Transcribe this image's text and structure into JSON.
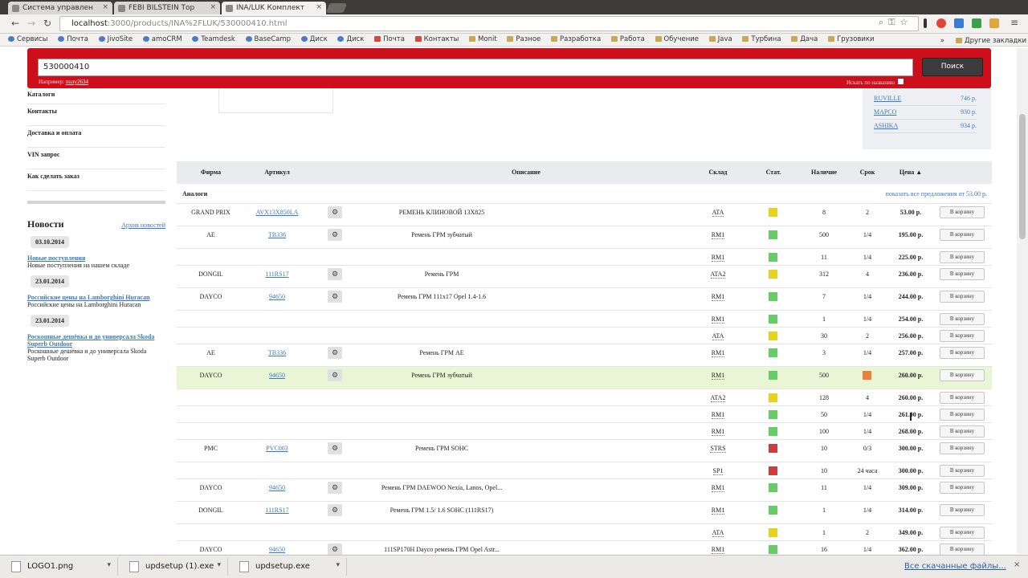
{
  "browser": {
    "tabs": [
      {
        "label": "Система управлен",
        "active": false
      },
      {
        "label": "FEBI BILSTEIN Тор",
        "active": false
      },
      {
        "label": "INA/LUK Комплект",
        "active": true
      }
    ],
    "url_host": "localhost",
    "url_path": ":3000/products/INA%2FLUK/530000410.html",
    "bookmarks": [
      "Сервисы",
      "Почта",
      "JivoSite",
      "amoCRM",
      "Teamdesk",
      "BaseCamp",
      "Диск",
      "Диск",
      "Почта",
      "Контакты",
      "Monit",
      "Разное",
      "Разработка",
      "Работа",
      "Обучение",
      "Java",
      "Турбина",
      "Дача",
      "Грузовики"
    ],
    "bookmarks_more": "»",
    "other_bookmarks": "Другие закладки"
  },
  "search": {
    "value": "530000410",
    "button": "Поиск",
    "hint_prefix": "Например:",
    "hint_example": "полу2634",
    "by_name": "Искать по названию"
  },
  "sidebar": {
    "menu": [
      "Каталоги",
      "Контакты",
      "Доставка и оплата",
      "VIN запрос",
      "Как сделать заказ"
    ],
    "news_title": "Новости",
    "news_archive": "Архив новостей",
    "news": [
      {
        "date": "03.10.2014",
        "title": "Новые поступления",
        "text": "Новые поступления на нашем складе"
      },
      {
        "date": "23.01.2014",
        "title": "Российские цены на Lamborghini Huracan",
        "text": "Российские цены на Lamborghini Huracan"
      },
      {
        "date": "23.01.2014",
        "title": "Роскошные дешёвка и до универсала Skoda Superb Outdoor",
        "text": "Роскошные дешёвка и до универсала Skoda Superb Outdoor"
      }
    ]
  },
  "offers_box": [
    {
      "name": "RUVILLE",
      "price": "746 р."
    },
    {
      "name": "MAPCO",
      "price": "930 р."
    },
    {
      "name": "ASHIKA",
      "price": "934 р."
    }
  ],
  "table": {
    "headers": [
      "Фирма",
      "Артикул",
      "Описание",
      "Склад",
      "Стат.",
      "Наличие",
      "Срок",
      "Цена ▲"
    ],
    "analog_label": "Аналоги",
    "show_all": "показать все предложения от 53.00 р.",
    "cart_label": "В корзину",
    "rows": [
      {
        "brand": "GRAND PRIX",
        "art": "AVX13X850LA",
        "desc": "РЕМЕНЬ КЛИНОВОЙ 13X825",
        "wh": "ATA",
        "stat": "yellow",
        "qty": "8",
        "term": "2",
        "price": "53.00 р."
      },
      {
        "brand": "AE",
        "art": "TB336",
        "desc": "Ремень ГРМ зубчатый",
        "wh": "RM1",
        "stat": "green",
        "qty": "500",
        "term": "1/4",
        "price": "195.00 р."
      },
      {
        "brand": "",
        "art": "",
        "desc": "",
        "wh": "RM1",
        "stat": "green",
        "qty": "11",
        "term": "1/4",
        "price": "225.00 р."
      },
      {
        "brand": "DONGIL",
        "art": "111RS17",
        "desc": "Ремень ГРМ",
        "wh": "ATA2",
        "stat": "yellow",
        "qty": "312",
        "term": "4",
        "price": "236.00 р."
      },
      {
        "brand": "DAYCO",
        "art": "94650",
        "desc": "Ремень ГРМ 111х17 Opel 1.4-1.6",
        "wh": "RM1",
        "stat": "green",
        "qty": "7",
        "term": "1/4",
        "price": "244.00 р."
      },
      {
        "brand": "",
        "art": "",
        "desc": "",
        "wh": "RM1",
        "stat": "green",
        "qty": "1",
        "term": "1/4",
        "price": "254.00 р."
      },
      {
        "brand": "",
        "art": "",
        "desc": "",
        "wh": "ATA",
        "stat": "yellow",
        "qty": "30",
        "term": "2",
        "price": "256.00 р."
      },
      {
        "brand": "AE",
        "art": "TB336",
        "desc": "Ремень ГРМ AE",
        "wh": "RM1",
        "stat": "green",
        "qty": "3",
        "term": "1/4",
        "price": "257.00 р."
      },
      {
        "brand": "DAYCO",
        "art": "94650",
        "desc": "Ремень ГРМ зубчатый",
        "wh": "RM1",
        "stat": "green",
        "qty": "500",
        "term": "orange",
        "price": "260.00 р.",
        "hl": true
      },
      {
        "brand": "",
        "art": "",
        "desc": "",
        "wh": "ATA2",
        "stat": "yellow",
        "qty": "128",
        "term": "4",
        "price": "260.00 р."
      },
      {
        "brand": "",
        "art": "",
        "desc": "",
        "wh": "RM1",
        "stat": "green",
        "qty": "50",
        "term": "1/4",
        "price": "261.00 р."
      },
      {
        "brand": "",
        "art": "",
        "desc": "",
        "wh": "RM1",
        "stat": "green",
        "qty": "100",
        "term": "1/4",
        "price": "268.00 р."
      },
      {
        "brand": "PMC",
        "art": "PVC003",
        "desc": "Ремень ГРМ SOHC",
        "wh": "STRS",
        "stat": "red",
        "qty": "10",
        "term": "0/3",
        "price": "300.00 р."
      },
      {
        "brand": "",
        "art": "",
        "desc": "",
        "wh": "SP1",
        "stat": "red",
        "qty": "10",
        "term": "24 часа",
        "price": "300.00 р."
      },
      {
        "brand": "DAYCO",
        "art": "94650",
        "desc": "Ремень ГРМ DAEWOO Nexia, Lanos, Opel...",
        "wh": "RM1",
        "stat": "green",
        "qty": "11",
        "term": "1/4",
        "price": "309.00 р."
      },
      {
        "brand": "DONGIL",
        "art": "111RS17",
        "desc": "Ремень ГРМ 1.5/ 1.6 SOHC (111RS17)",
        "wh": "RM1",
        "stat": "green",
        "qty": "1",
        "term": "1/4",
        "price": "314.00 р."
      },
      {
        "brand": "",
        "art": "",
        "desc": "",
        "wh": "ATA",
        "stat": "yellow",
        "qty": "1",
        "term": "2",
        "price": "349.00 р."
      },
      {
        "brand": "DAYCO",
        "art": "94650",
        "desc": "111SP170H Dayco ремень ГРМ Opel Astr...",
        "wh": "RM1",
        "stat": "green",
        "qty": "16",
        "term": "1/4",
        "price": "362.00 р."
      }
    ]
  },
  "downloads": {
    "items": [
      "LOGO1.png",
      "updsetup (1).exe",
      "updsetup.exe"
    ],
    "show_all": "Все скачанные файлы...",
    "close": "×"
  },
  "colors": {
    "green": "#66cc66",
    "yellow": "#e8d21d",
    "red": "#d23b3b",
    "orange": "#e8813a",
    "accent": "#cc0f1a"
  }
}
